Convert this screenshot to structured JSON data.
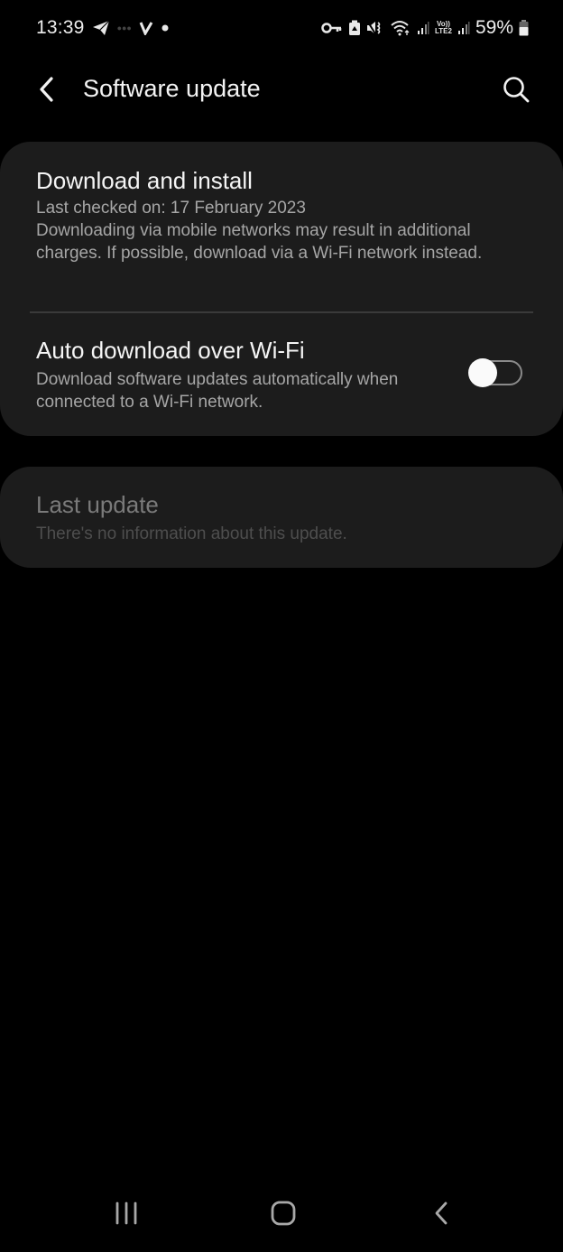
{
  "status_bar": {
    "time": "13:39",
    "left_icons": [
      "telegram-icon",
      "notification-icon",
      "vpn-app-icon",
      "dot-icon"
    ],
    "right_icons": [
      "key-icon",
      "battery-saver-icon",
      "mute-vibrate-icon",
      "wifi-icon",
      "signal-icon",
      "volte-lte2-icon",
      "signal-2-icon"
    ],
    "volte_top": "Vo))",
    "volte_bottom": "LTE2",
    "battery_percent": "59%"
  },
  "header": {
    "title": "Software update",
    "back_icon": "chevron-left-icon",
    "search_icon": "search-icon"
  },
  "settings": {
    "download_install": {
      "title": "Download and install",
      "last_checked": "Last checked on: 17 February 2023",
      "note": "Downloading via mobile networks may result in additional charges. If possible, download via a Wi-Fi network instead."
    },
    "auto_download": {
      "title": "Auto download over Wi-Fi",
      "description": "Download software updates automatically when connected to a Wi-Fi network.",
      "enabled": false
    },
    "last_update": {
      "title": "Last update",
      "description": "There's no information about this update.",
      "disabled": true
    }
  },
  "nav_bar": {
    "recents_icon": "recents-icon",
    "home_icon": "home-icon",
    "back_icon": "back-icon"
  },
  "colors": {
    "background": "#000000",
    "card": "#1c1c1c",
    "primary_text": "#f5f5f5",
    "secondary_text": "#a6a6a6",
    "disabled_title": "#7a7a7a",
    "disabled_text": "#4e4e4e"
  }
}
